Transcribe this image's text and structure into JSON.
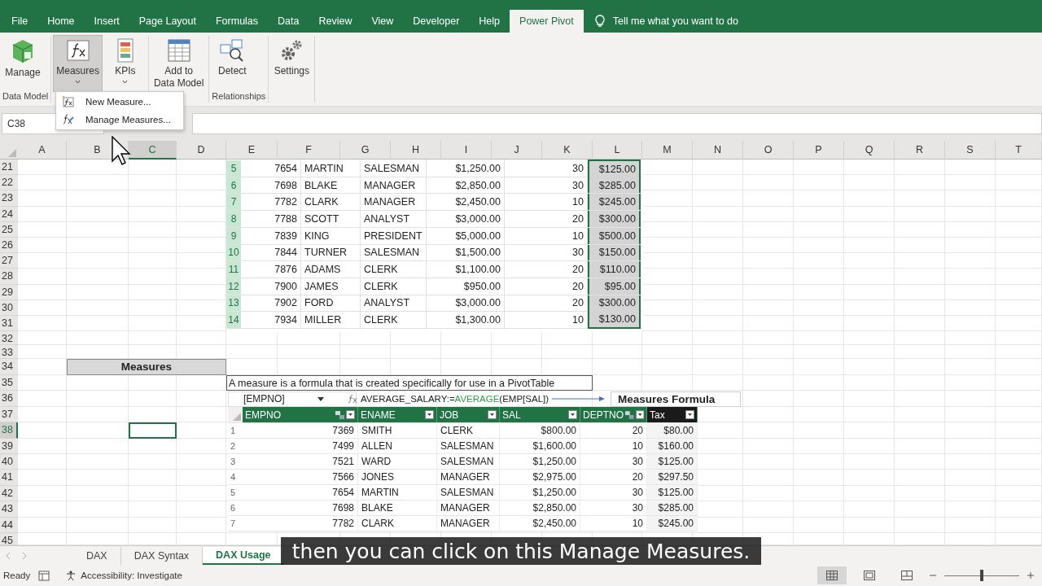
{
  "ribbon": {
    "tabs": [
      {
        "label": "File",
        "selected": false
      },
      {
        "label": "Home",
        "selected": false
      },
      {
        "label": "Insert",
        "selected": false
      },
      {
        "label": "Page Layout",
        "selected": false
      },
      {
        "label": "Formulas",
        "selected": false
      },
      {
        "label": "Data",
        "selected": false
      },
      {
        "label": "Review",
        "selected": false
      },
      {
        "label": "View",
        "selected": false
      },
      {
        "label": "Developer",
        "selected": false
      },
      {
        "label": "Help",
        "selected": false
      },
      {
        "label": "Power Pivot",
        "selected": true
      }
    ],
    "tell_me": "Tell me what you want to do",
    "groups": [
      {
        "label": "Data Model",
        "buttons": [
          {
            "kind": "manage",
            "lines": [
              "Manage"
            ],
            "pressed": false,
            "dropdown": false
          }
        ]
      },
      {
        "buttons": [
          {
            "kind": "measures",
            "lines": [
              "Measures"
            ],
            "pressed": true,
            "dropdown": true
          },
          {
            "kind": "kpis",
            "lines": [
              "KPIs"
            ],
            "pressed": false,
            "dropdown": true
          }
        ]
      },
      {
        "buttons": [
          {
            "kind": "add",
            "lines": [
              "Add to",
              "Data Model"
            ],
            "pressed": false,
            "dropdown": false
          }
        ]
      },
      {
        "label": "Relationships",
        "buttons": [
          {
            "kind": "detect",
            "lines": [
              "Detect"
            ],
            "pressed": false,
            "dropdown": false
          }
        ]
      },
      {
        "buttons": [
          {
            "kind": "settings",
            "lines": [
              "Settings"
            ],
            "pressed": false,
            "dropdown": false
          }
        ]
      }
    ]
  },
  "menu": {
    "items": [
      {
        "kind": "new",
        "label": "New Measure..."
      },
      {
        "kind": "manage",
        "label": "Manage Measures..."
      }
    ]
  },
  "name_box": "C38",
  "sheet": {
    "columns": [
      {
        "label": "A",
        "selected": false
      },
      {
        "label": "B",
        "selected": false
      },
      {
        "label": "C",
        "selected": true
      },
      {
        "label": "D",
        "selected": false
      },
      {
        "label": "E",
        "selected": false
      },
      {
        "label": "F",
        "selected": false
      },
      {
        "label": "G",
        "selected": false
      },
      {
        "label": "H",
        "selected": false
      },
      {
        "label": "I",
        "selected": false
      },
      {
        "label": "J",
        "selected": false
      },
      {
        "label": "K",
        "selected": false
      },
      {
        "label": "L",
        "selected": false
      },
      {
        "label": "M",
        "selected": false
      },
      {
        "label": "N",
        "selected": false
      },
      {
        "label": "O",
        "selected": false
      },
      {
        "label": "P",
        "selected": false
      },
      {
        "label": "Q",
        "selected": false
      },
      {
        "label": "R",
        "selected": false
      },
      {
        "label": "S",
        "selected": false
      },
      {
        "label": "T",
        "selected": false
      }
    ],
    "rows": [
      {
        "label": "21",
        "selected": false
      },
      {
        "label": "22",
        "selected": false
      },
      {
        "label": "23",
        "selected": false
      },
      {
        "label": "24",
        "selected": false
      },
      {
        "label": "25",
        "selected": false
      },
      {
        "label": "26",
        "selected": false
      },
      {
        "label": "27",
        "selected": false
      },
      {
        "label": "28",
        "selected": false
      },
      {
        "label": "29",
        "selected": false
      },
      {
        "label": "30",
        "selected": false
      },
      {
        "label": "31",
        "selected": false
      },
      {
        "label": "32",
        "selected": false
      },
      {
        "label": "33",
        "selected": false
      },
      {
        "label": "34",
        "selected": false
      },
      {
        "label": "35",
        "selected": false
      },
      {
        "label": "36",
        "selected": false
      },
      {
        "label": "37",
        "selected": false
      },
      {
        "label": "38",
        "selected": true
      },
      {
        "label": "39",
        "selected": false
      },
      {
        "label": "40",
        "selected": false
      },
      {
        "label": "41",
        "selected": false
      },
      {
        "label": "42",
        "selected": false
      },
      {
        "label": "43",
        "selected": false
      },
      {
        "label": "44",
        "selected": false
      },
      {
        "label": "45",
        "selected": false
      }
    ]
  },
  "table1": {
    "tax_selected": true,
    "rows": [
      {
        "index": "5",
        "values": [
          "7654",
          "MARTIN",
          "SALESMAN",
          "$1,250.00",
          "30",
          "$125.00"
        ]
      },
      {
        "index": "6",
        "values": [
          "7698",
          "BLAKE",
          "MANAGER",
          "$2,850.00",
          "30",
          "$285.00"
        ]
      },
      {
        "index": "7",
        "values": [
          "7782",
          "CLARK",
          "MANAGER",
          "$2,450.00",
          "10",
          "$245.00"
        ]
      },
      {
        "index": "8",
        "values": [
          "7788",
          "SCOTT",
          "ANALYST",
          "$3,000.00",
          "20",
          "$300.00"
        ]
      },
      {
        "index": "9",
        "values": [
          "7839",
          "KING",
          "PRESIDENT",
          "$5,000.00",
          "10",
          "$500.00"
        ]
      },
      {
        "index": "10",
        "values": [
          "7844",
          "TURNER",
          "SALESMAN",
          "$1,500.00",
          "30",
          "$150.00"
        ]
      },
      {
        "index": "11",
        "values": [
          "7876",
          "ADAMS",
          "CLERK",
          "$1,100.00",
          "20",
          "$110.00"
        ]
      },
      {
        "index": "12",
        "values": [
          "7900",
          "JAMES",
          "CLERK",
          "$950.00",
          "20",
          "$95.00"
        ]
      },
      {
        "index": "13",
        "values": [
          "7902",
          "FORD",
          "ANALYST",
          "$3,000.00",
          "20",
          "$300.00"
        ]
      },
      {
        "index": "14",
        "values": [
          "7934",
          "MILLER",
          "CLERK",
          "$1,300.00",
          "10",
          "$130.00"
        ]
      }
    ]
  },
  "section_title": "Measures",
  "description": "A measure is a formula that is created specifically for use in a PivotTable",
  "pivot_formula": {
    "name_box": "[EMPNO]",
    "parts": [
      {
        "kind": "plain",
        "text": "AVERAGE_SALARY:="
      },
      {
        "kind": "function",
        "text": "AVERAGE"
      },
      {
        "kind": "plain",
        "text": "(EMP[SAL])"
      }
    ],
    "callout": "Measures Formula"
  },
  "table2": {
    "columns": [
      {
        "label": "EMPNO",
        "selected": false,
        "related": true
      },
      {
        "label": "ENAME",
        "selected": false,
        "related": false
      },
      {
        "label": "JOB",
        "selected": false,
        "related": false
      },
      {
        "label": "SAL",
        "selected": false,
        "related": false
      },
      {
        "label": "DEPTNO",
        "selected": false,
        "related": true
      },
      {
        "label": "Tax",
        "selected": true,
        "related": false
      }
    ],
    "rows": [
      {
        "index": "1",
        "values": [
          "7369",
          "SMITH",
          "CLERK",
          "$800.00",
          "20",
          "$80.00"
        ]
      },
      {
        "index": "2",
        "values": [
          "7499",
          "ALLEN",
          "SALESMAN",
          "$1,600.00",
          "10",
          "$160.00"
        ]
      },
      {
        "index": "3",
        "values": [
          "7521",
          "WARD",
          "SALESMAN",
          "$1,250.00",
          "30",
          "$125.00"
        ]
      },
      {
        "index": "4",
        "values": [
          "7566",
          "JONES",
          "MANAGER",
          "$2,975.00",
          "20",
          "$297.50"
        ]
      },
      {
        "index": "5",
        "values": [
          "7654",
          "MARTIN",
          "SALESMAN",
          "$1,250.00",
          "30",
          "$125.00"
        ]
      },
      {
        "index": "6",
        "values": [
          "7698",
          "BLAKE",
          "MANAGER",
          "$2,850.00",
          "30",
          "$285.00"
        ]
      },
      {
        "index": "7",
        "values": [
          "7782",
          "CLARK",
          "MANAGER",
          "$2,450.00",
          "10",
          "$245.00"
        ]
      }
    ]
  },
  "sheet_tabs": [
    {
      "label": "DAX",
      "selected": false
    },
    {
      "label": "DAX Syntax",
      "selected": false
    },
    {
      "label": "DAX Usage",
      "selected": true
    }
  ],
  "caption": "then you can click on this Manage Measures.",
  "status_bar": {
    "ready": "Ready",
    "accessibility": "Accessibility: Investigate",
    "views": [
      {
        "kind": "normal",
        "selected": true
      },
      {
        "kind": "page_layout",
        "selected": false
      },
      {
        "kind": "page_break",
        "selected": false
      }
    ],
    "zoom": {
      "level": 0.5
    }
  }
}
